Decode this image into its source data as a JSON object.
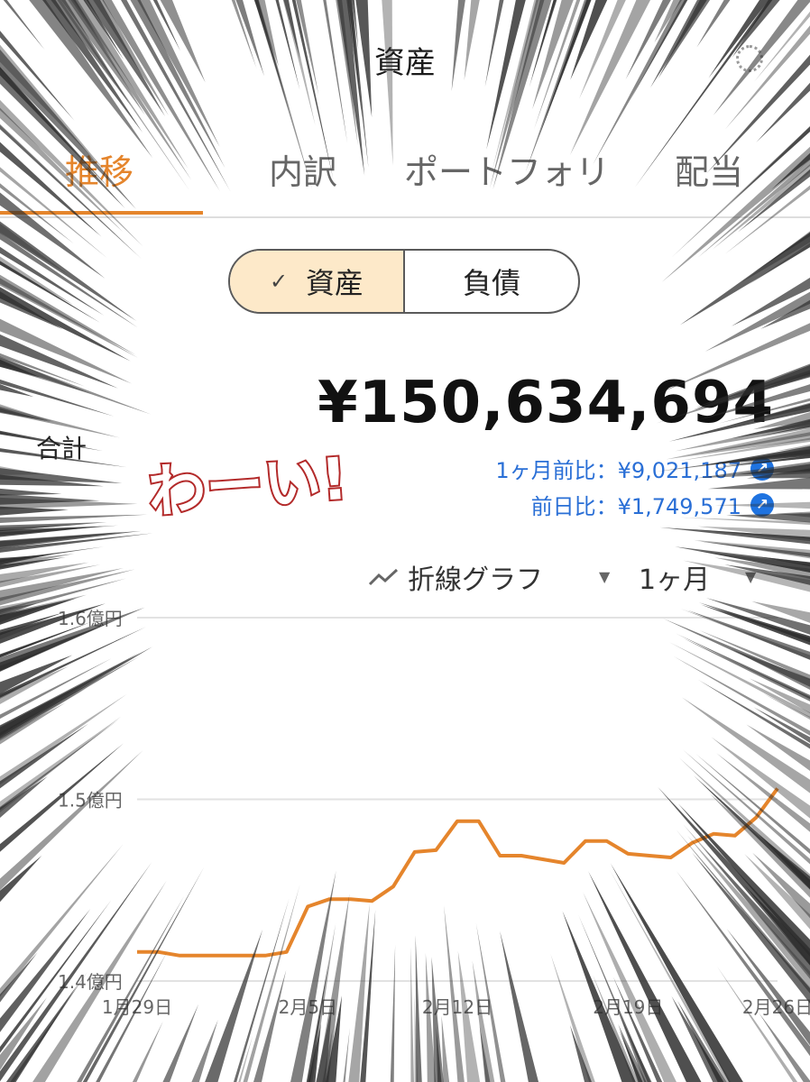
{
  "header": {
    "title": "資産"
  },
  "tabs": [
    {
      "label": "推移",
      "active": true
    },
    {
      "label": "内訳",
      "active": false
    },
    {
      "label": "ポートフォリ",
      "active": false
    },
    {
      "label": "配当",
      "active": false
    }
  ],
  "segment": {
    "assets": "資産",
    "liabilities": "負債",
    "selected": "資産"
  },
  "summary": {
    "label": "合計",
    "total": "¥150,634,694",
    "month_compare": "1ヶ月前比：¥9,021,187",
    "day_compare": "前日比：¥1,749,571"
  },
  "overlay_text": "わーい!",
  "controls": {
    "chart_type": "折線グラフ",
    "period": "1ヶ月"
  },
  "colors": {
    "accent": "#e5852c",
    "link": "#2a6fd6",
    "line": "#e5852c"
  },
  "chart_data": {
    "type": "line",
    "y_unit": "億円",
    "ylim": [
      1.4,
      1.6
    ],
    "ytick_labels": [
      "1.6億円",
      "1.5億円",
      "1.4億円"
    ],
    "yticks": [
      1.6,
      1.5,
      1.4
    ],
    "xtick_labels": [
      "1月29日",
      "2月5日",
      "2月12日",
      "2月19日",
      "2月26日"
    ],
    "x_count": 29,
    "xtick_index": [
      0,
      7,
      14,
      21,
      28
    ],
    "series": [
      {
        "values": [
          1.416,
          1.416,
          1.414,
          1.414,
          1.414,
          1.414,
          1.414,
          1.416,
          1.441,
          1.445,
          1.445,
          1.444,
          1.452,
          1.471,
          1.472,
          1.488,
          1.488,
          1.469,
          1.469,
          1.467,
          1.465,
          1.477,
          1.477,
          1.47,
          1.469,
          1.468,
          1.476,
          1.481,
          1.48,
          1.49,
          1.506
        ]
      }
    ]
  }
}
